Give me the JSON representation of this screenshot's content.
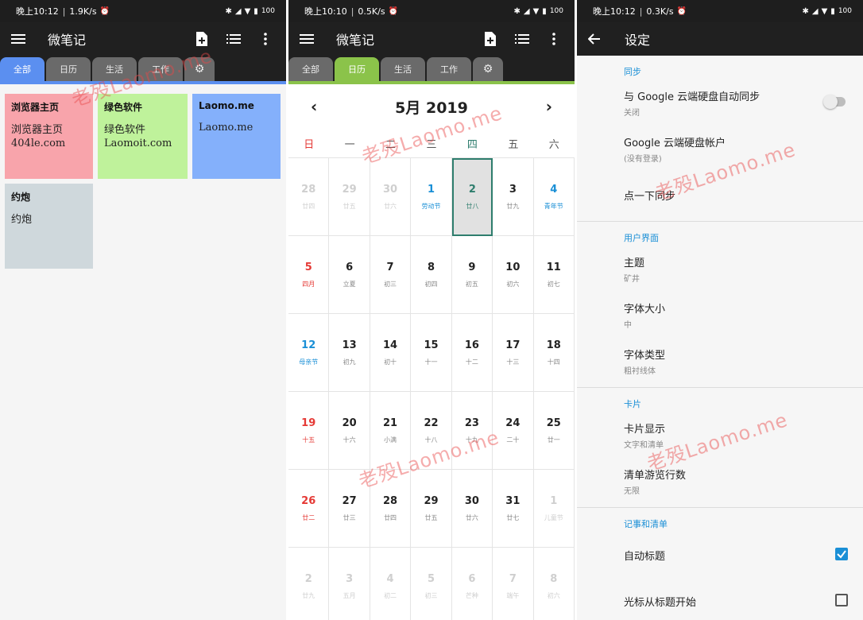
{
  "status": [
    {
      "time": "晚上10:12",
      "speed": "1.9K/s",
      "battery": "100"
    },
    {
      "time": "晚上10:10",
      "speed": "0.5K/s",
      "battery": "100"
    },
    {
      "time": "晚上10:12",
      "speed": "0.3K/s",
      "battery": "100"
    }
  ],
  "app": {
    "title": "微笔记"
  },
  "tabs": [
    "全部",
    "日历",
    "生活",
    "工作"
  ],
  "colors": {
    "accent_blue": "#5b8ff0",
    "accent_green": "#8bc34a",
    "today_border": "#2e7d6d",
    "setting_blue": "#1a8fd6",
    "sunday_red": "#e53935"
  },
  "notes": [
    {
      "title": "浏览器主页",
      "body1": "浏览器主页",
      "body2": "404le.com",
      "color": "#f8a4ab"
    },
    {
      "title": "绿色软件",
      "body1": "绿色软件",
      "body2": "Laomoit.com",
      "color": "#bff29b"
    },
    {
      "title": "Laomo.me",
      "body1": "Laomo.me",
      "body2": "",
      "color": "#84b0fb"
    },
    {
      "title": "约炮",
      "body1": "约炮",
      "body2": "",
      "color": "#cfd8dc"
    }
  ],
  "calendar": {
    "month_title": "5月 2019",
    "prev": "‹",
    "next": "›",
    "weekdays": [
      "日",
      "一",
      "二",
      "三",
      "四",
      "五",
      "六"
    ],
    "days": [
      {
        "d": "28",
        "l": "廿四",
        "out": true
      },
      {
        "d": "29",
        "l": "廿五",
        "out": true
      },
      {
        "d": "30",
        "l": "廿六",
        "out": true
      },
      {
        "d": "1",
        "l": "劳动节",
        "hol": true
      },
      {
        "d": "2",
        "l": "廿八",
        "today": true
      },
      {
        "d": "3",
        "l": "廿九"
      },
      {
        "d": "4",
        "l": "青年节",
        "hol": true
      },
      {
        "d": "5",
        "l": "四月",
        "sun": true
      },
      {
        "d": "6",
        "l": "立夏"
      },
      {
        "d": "7",
        "l": "初三"
      },
      {
        "d": "8",
        "l": "初四"
      },
      {
        "d": "9",
        "l": "初五"
      },
      {
        "d": "10",
        "l": "初六"
      },
      {
        "d": "11",
        "l": "初七"
      },
      {
        "d": "12",
        "l": "母亲节",
        "hol": true
      },
      {
        "d": "13",
        "l": "初九"
      },
      {
        "d": "14",
        "l": "初十"
      },
      {
        "d": "15",
        "l": "十一"
      },
      {
        "d": "16",
        "l": "十二"
      },
      {
        "d": "17",
        "l": "十三"
      },
      {
        "d": "18",
        "l": "十四"
      },
      {
        "d": "19",
        "l": "十五",
        "sun": true
      },
      {
        "d": "20",
        "l": "十六"
      },
      {
        "d": "21",
        "l": "小满"
      },
      {
        "d": "22",
        "l": "十八"
      },
      {
        "d": "23",
        "l": "十九"
      },
      {
        "d": "24",
        "l": "二十"
      },
      {
        "d": "25",
        "l": "廿一"
      },
      {
        "d": "26",
        "l": "廿二",
        "sun": true
      },
      {
        "d": "27",
        "l": "廿三"
      },
      {
        "d": "28",
        "l": "廿四"
      },
      {
        "d": "29",
        "l": "廿五"
      },
      {
        "d": "30",
        "l": "廿六"
      },
      {
        "d": "31",
        "l": "廿七"
      },
      {
        "d": "1",
        "l": "儿童节",
        "out": true
      },
      {
        "d": "2",
        "l": "廿九",
        "out": true
      },
      {
        "d": "3",
        "l": "五月",
        "out": true
      },
      {
        "d": "4",
        "l": "初二",
        "out": true
      },
      {
        "d": "5",
        "l": "初三",
        "out": true
      },
      {
        "d": "6",
        "l": "芒种",
        "out": true
      },
      {
        "d": "7",
        "l": "端午",
        "out": true
      },
      {
        "d": "8",
        "l": "初六",
        "out": true
      }
    ]
  },
  "settings": {
    "title": "设定",
    "sections": [
      {
        "title": "同步",
        "items": [
          {
            "main": "与 Google 云端硬盘自动同步",
            "sub": "关闭",
            "control": "toggle"
          },
          {
            "main": "Google 云端硬盘帐户",
            "sub": "(没有登录)"
          },
          {
            "main": "点一下同步",
            "sub": ""
          }
        ]
      },
      {
        "title": "用户界面",
        "items": [
          {
            "main": "主题",
            "sub": "矿井"
          },
          {
            "main": "字体大小",
            "sub": "中"
          },
          {
            "main": "字体类型",
            "sub": "粗衬线体"
          }
        ]
      },
      {
        "title": "卡片",
        "items": [
          {
            "main": "卡片显示",
            "sub": "文字和清单"
          },
          {
            "main": "清单游览行数",
            "sub": "无限"
          }
        ]
      },
      {
        "title": "记事和清单",
        "items": [
          {
            "main": "自动标题",
            "sub": "",
            "control": "checked"
          },
          {
            "main": "光标从标题开始",
            "sub": "",
            "control": "unchecked"
          }
        ]
      }
    ]
  },
  "watermark": "老殁Laomo.me"
}
